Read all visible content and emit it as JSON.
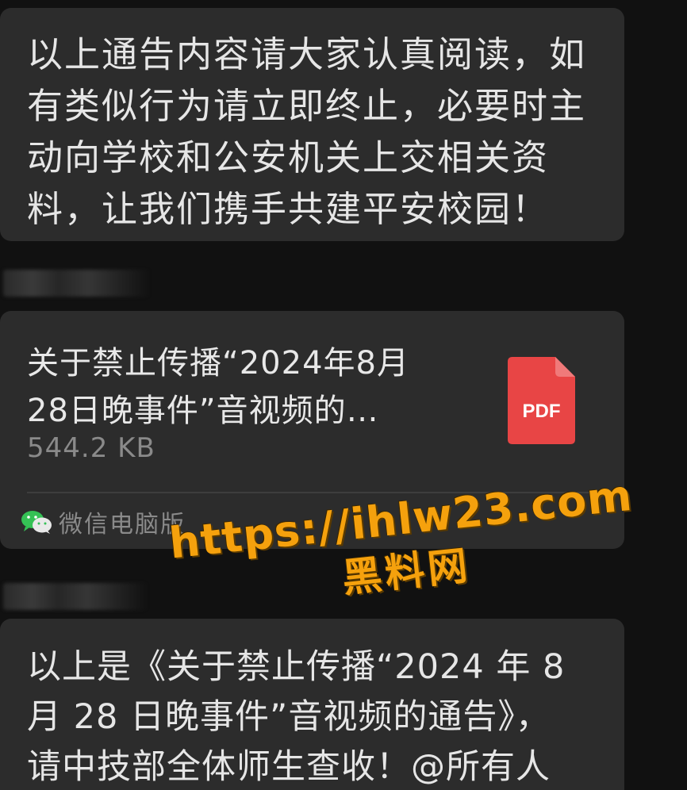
{
  "messages": {
    "notice": {
      "lines": [
        "以上通告内容请大家认真阅读，如",
        "有类似行为请立即终止，必要时主",
        "动向学校和公安机关上交相关资",
        "料，让我们携手共建平安校园！"
      ]
    },
    "file": {
      "title_lines": [
        "关于禁止传播“2024年8月",
        "28日晚事件”音视频的…"
      ],
      "size": "544.2 KB",
      "file_type_badge": "PDF",
      "file_icon": "pdf-file-icon",
      "file_icon_color": "#e84545",
      "source_app_icon": "wechat-icon",
      "source_app": "微信电脑版"
    },
    "announcement": {
      "lines": [
        " 以上是《关于禁止传播“2024 年 8",
        "月 28 日晚事件”音视频的通告》，",
        "请中技部全体师生查收！@所有人"
      ]
    }
  },
  "watermark": {
    "url": "https://ihlw23.com",
    "site_name": "黑料网",
    "color": "#f5a10d"
  },
  "theme": {
    "background": "#111111",
    "bubble": "#2c2c2c"
  }
}
